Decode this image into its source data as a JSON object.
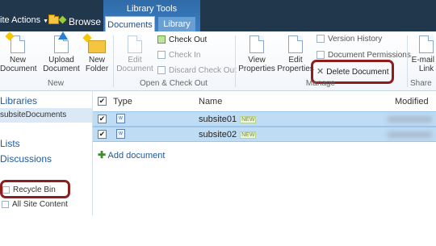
{
  "topbar": {
    "site_actions": "ite Actions",
    "browse_tab": "Browse",
    "context_group": "Library Tools",
    "documents_tab": "Documents",
    "library_tab": "Library"
  },
  "ribbon": {
    "new": {
      "new_doc_line1": "New",
      "new_doc_line2": "Document",
      "upload_line1": "Upload",
      "upload_line2": "Document",
      "new_folder_line1": "New",
      "new_folder_line2": "Folder",
      "group": "New"
    },
    "open_checkout": {
      "edit_line1": "Edit",
      "edit_line2": "Document",
      "check_out": "Check Out",
      "check_in": "Check In",
      "discard": "Discard Check Out",
      "group": "Open & Check Out"
    },
    "manage": {
      "view_props_line1": "View",
      "view_props_line2": "Properties",
      "edit_props_line1": "Edit",
      "edit_props_line2": "Properties",
      "version_history": "Version History",
      "doc_permissions": "Document Permissions",
      "delete_document": "Delete Document",
      "group": "Manage"
    },
    "share": {
      "email_line1": "E-mail a",
      "email_line2": "Link",
      "group": "Share"
    }
  },
  "nav": {
    "libraries": "Libraries",
    "subsite_documents": "subsiteDocuments",
    "lists": "Lists",
    "discussions": "Discussions",
    "recycle_bin": "Recycle Bin",
    "all_site_content": "All Site Content"
  },
  "list": {
    "columns": {
      "type": "Type",
      "name": "Name",
      "modified": "Modified"
    },
    "rows": [
      {
        "name": "subsite01",
        "badge": "NEW"
      },
      {
        "name": "subsite02",
        "badge": "NEW"
      }
    ],
    "add_document": "Add document",
    "checkmark": "✔"
  },
  "colors": {
    "topbar": "#21374c",
    "context_tab": "#3c7fc4",
    "selection": "#bfdcf5",
    "highlight_ring": "#8e1e1e"
  }
}
